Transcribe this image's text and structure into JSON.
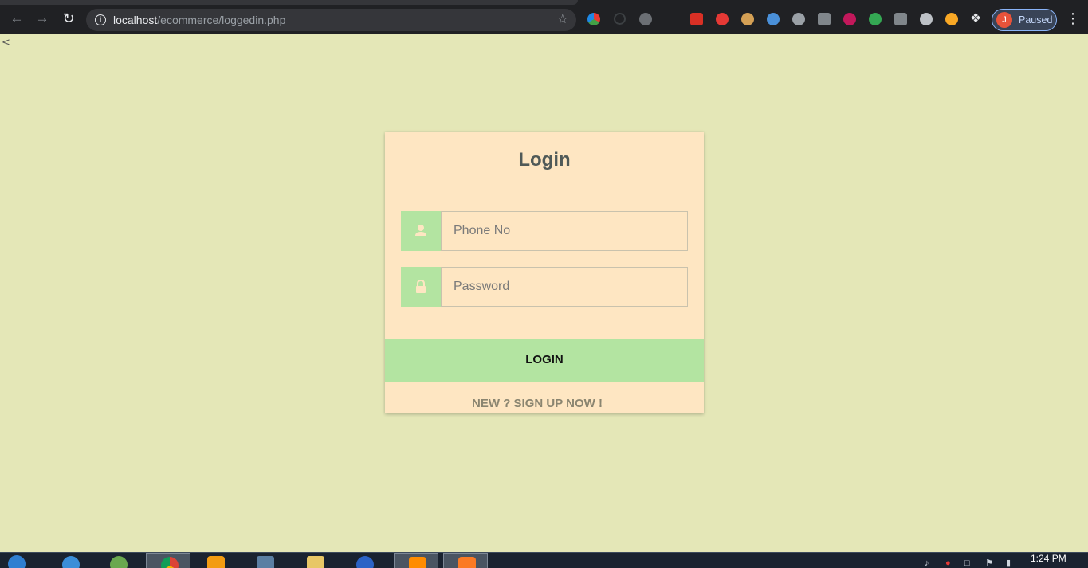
{
  "browser": {
    "url_host": "localhost",
    "url_path": "/ecommerce/loggedin.php",
    "profile_initial": "J",
    "profile_status": "Paused",
    "icons": {
      "back": "back-arrow-icon",
      "forward": "forward-arrow-icon",
      "reload": "reload-icon",
      "site_info": "info-icon",
      "bookmark": "star-icon",
      "extensions": "puzzle-icon",
      "menu": "kebab-menu-icon"
    }
  },
  "page": {
    "stray_text": "<"
  },
  "login_form": {
    "title": "Login",
    "phone": {
      "placeholder": "Phone No",
      "value": "",
      "icon": "user-icon"
    },
    "password": {
      "placeholder": "Password",
      "value": "",
      "icon": "lock-icon"
    },
    "login_button": "LOGIN",
    "signup_link": "NEW ? SIGN UP NOW !"
  },
  "taskbar": {
    "clock": "1:24 PM"
  },
  "colors": {
    "page_bg": "#e4e7b7",
    "card_bg": "#fee6c2",
    "accent_green": "#b3e4a1",
    "title_text": "#505a58"
  }
}
